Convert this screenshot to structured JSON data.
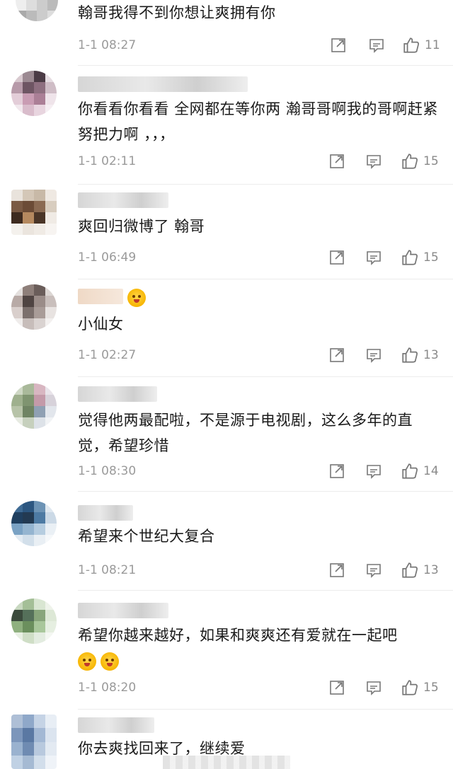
{
  "comments": [
    {
      "text": "翰哥我得不到你想让爽拥有你",
      "time": "1-1 08:27",
      "likes": "11"
    },
    {
      "text": "你看看你看看 全网都在等你两 瀚哥哥啊我的哥啊赶紧努把力啊 ，，，",
      "time": "1-1 02:11",
      "likes": "15"
    },
    {
      "text": "爽回归微博了   翰哥",
      "time": "1-1 06:49",
      "likes": "15"
    },
    {
      "text": "小仙女",
      "time": "1-1 02:27",
      "likes": "13"
    },
    {
      "text": "觉得他两最配啦，不是源于电视剧，这么多年的直觉，希望珍惜",
      "time": "1-1 08:30",
      "likes": "14"
    },
    {
      "text": "希望来个世纪大复合",
      "time": "1-1 08:21",
      "likes": "13"
    },
    {
      "text": "希望你越来越好，如果和爽爽还有爱就在一起吧",
      "time": "1-1 08:20",
      "likes": "15"
    },
    {
      "text": "你去爽找回来了，继续爱",
      "time": "",
      "likes": ""
    }
  ],
  "icons": {
    "share": "share-icon",
    "comment": "comment-icon",
    "like": "thumbs-up-icon"
  },
  "colors": {
    "time": "#9a9a9a",
    "text": "#1a1a1a",
    "icon": "#777777"
  }
}
